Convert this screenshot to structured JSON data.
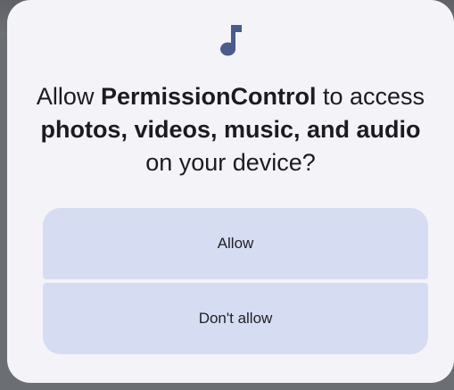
{
  "dialog": {
    "icon": "music-note-icon",
    "accent_color": "#4a5b8c",
    "message": {
      "prefix": "Allow ",
      "app_name": "PermissionControl",
      "mid1": " to access ",
      "media": "photos, videos, music, and audio",
      "suffix": " on your device?"
    },
    "allow_label": "Allow",
    "deny_label": "Don't allow"
  }
}
